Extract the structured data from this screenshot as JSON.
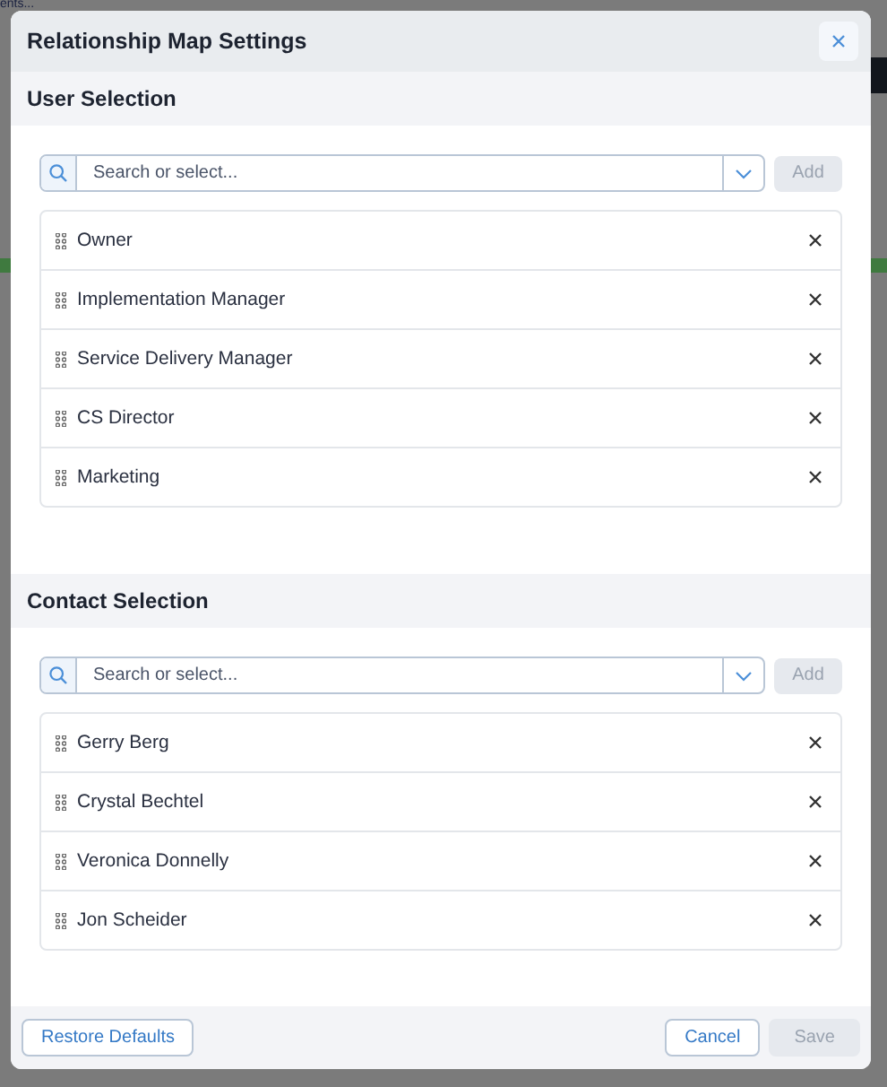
{
  "backdrop": {
    "text": "ents..."
  },
  "dialog": {
    "title": "Relationship Map Settings",
    "sections": [
      {
        "title": "User Selection",
        "search": {
          "placeholder": "Search or select..."
        },
        "add_button": {
          "label": "Add",
          "disabled": true
        },
        "items": [
          {
            "label": "Owner"
          },
          {
            "label": "Implementation Manager"
          },
          {
            "label": "Service Delivery Manager"
          },
          {
            "label": "CS Director"
          },
          {
            "label": "Marketing"
          }
        ]
      },
      {
        "title": "Contact Selection",
        "search": {
          "placeholder": "Search or select..."
        },
        "add_button": {
          "label": "Add",
          "disabled": true
        },
        "items": [
          {
            "label": "Gerry Berg"
          },
          {
            "label": "Crystal Bechtel"
          },
          {
            "label": "Veronica Donnelly"
          },
          {
            "label": "Jon Scheider"
          }
        ]
      }
    ],
    "footer": {
      "restore_button": {
        "label": "Restore Defaults",
        "disabled": false
      },
      "cancel_button": {
        "label": "Cancel",
        "disabled": false
      },
      "save_button": {
        "label": "Save",
        "disabled": true
      }
    }
  }
}
